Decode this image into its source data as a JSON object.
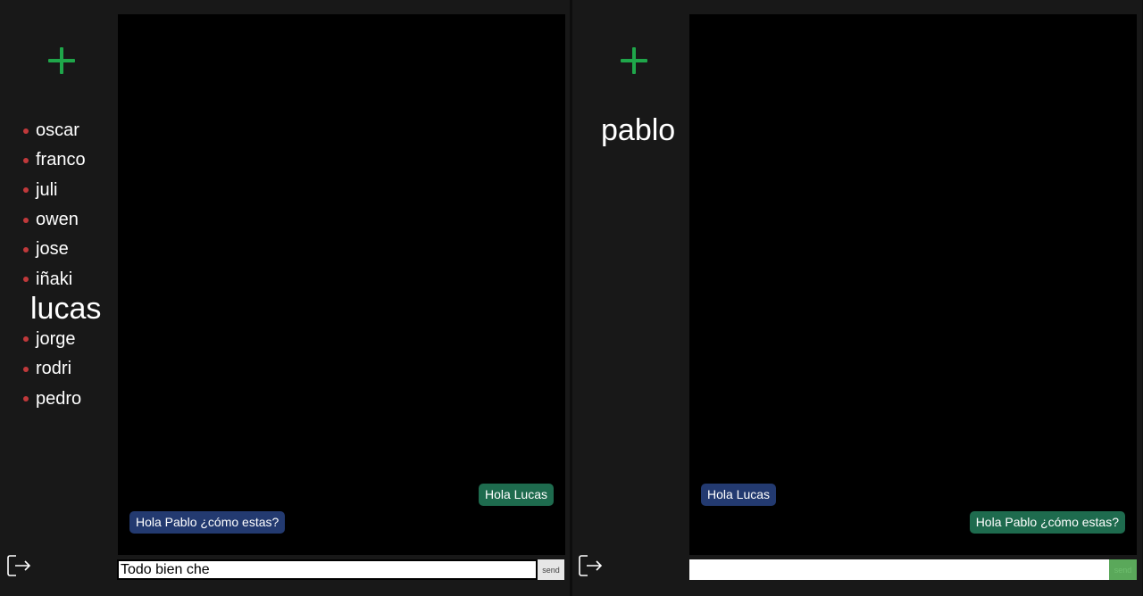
{
  "left": {
    "contacts": [
      {
        "name": "oscar",
        "active": false
      },
      {
        "name": "franco",
        "active": false
      },
      {
        "name": "juli",
        "active": false
      },
      {
        "name": "owen",
        "active": false
      },
      {
        "name": "jose",
        "active": false
      },
      {
        "name": "iñaki",
        "active": false
      },
      {
        "name": "lucas",
        "active": true
      },
      {
        "name": "jorge",
        "active": false
      },
      {
        "name": "rodri",
        "active": false
      },
      {
        "name": "pedro",
        "active": false
      }
    ],
    "messages": [
      {
        "text": "Hola Lucas",
        "direction": "out"
      },
      {
        "text": "Hola Pablo ¿cómo estas?",
        "direction": "in"
      }
    ],
    "input_value": "Todo bien che",
    "send_label": "send"
  },
  "right": {
    "contact": "pablo",
    "messages": [
      {
        "text": "Hola Lucas",
        "direction": "in"
      },
      {
        "text": "Hola Pablo ¿cómo estas?",
        "direction": "out"
      }
    ],
    "input_value": "",
    "send_label": "send"
  },
  "colors": {
    "add_icon": "#1fa64a",
    "status_dot": "#c0393b",
    "outgoing_bubble": "#1e6b4e",
    "incoming_bubble": "#233a70",
    "send_button_disabled": "#5aa85a"
  },
  "icons": {
    "add": "plus-icon",
    "logout": "logout-icon"
  }
}
